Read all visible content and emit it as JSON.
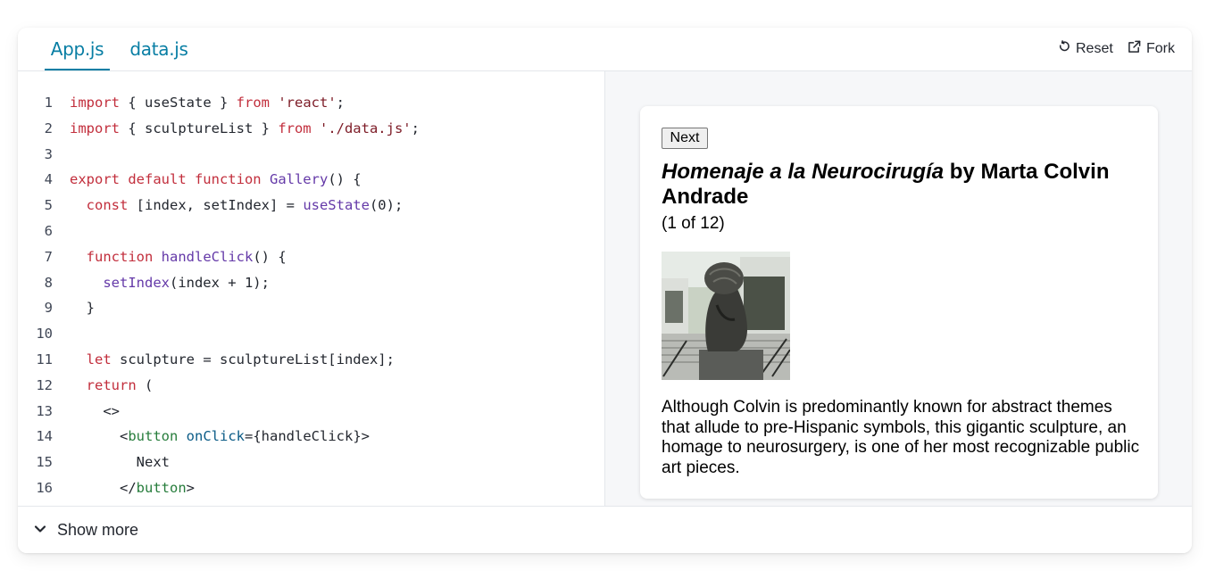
{
  "tabs": [
    {
      "label": "App.js",
      "active": true
    },
    {
      "label": "data.js",
      "active": false
    }
  ],
  "toolbar": {
    "reset_label": "Reset",
    "fork_label": "Fork"
  },
  "code": {
    "line_numbers": [
      "1",
      "2",
      "3",
      "4",
      "5",
      "6",
      "7",
      "8",
      "9",
      "10",
      "11",
      "12",
      "13",
      "14",
      "15",
      "16"
    ],
    "lines": [
      [
        {
          "t": "import",
          "c": "kw"
        },
        {
          "t": " { useState } "
        },
        {
          "t": "from",
          "c": "kw"
        },
        {
          "t": " "
        },
        {
          "t": "'react'",
          "c": "str"
        },
        {
          "t": ";"
        }
      ],
      [
        {
          "t": "import",
          "c": "kw"
        },
        {
          "t": " { sculptureList } "
        },
        {
          "t": "from",
          "c": "kw"
        },
        {
          "t": " "
        },
        {
          "t": "'./data.js'",
          "c": "str"
        },
        {
          "t": ";"
        }
      ],
      [],
      [
        {
          "t": "export default function",
          "c": "kw"
        },
        {
          "t": " "
        },
        {
          "t": "Gallery",
          "c": "fn"
        },
        {
          "t": "() {"
        }
      ],
      [
        {
          "t": "  "
        },
        {
          "t": "const",
          "c": "kw"
        },
        {
          "t": " [index, setIndex] = "
        },
        {
          "t": "useState",
          "c": "fn"
        },
        {
          "t": "(0);"
        }
      ],
      [],
      [
        {
          "t": "  "
        },
        {
          "t": "function",
          "c": "kw"
        },
        {
          "t": " "
        },
        {
          "t": "handleClick",
          "c": "fn"
        },
        {
          "t": "() {"
        }
      ],
      [
        {
          "t": "    "
        },
        {
          "t": "setIndex",
          "c": "fn"
        },
        {
          "t": "(index + 1);"
        }
      ],
      [
        {
          "t": "  }"
        }
      ],
      [],
      [
        {
          "t": "  "
        },
        {
          "t": "let",
          "c": "kw"
        },
        {
          "t": " sculpture = sculptureList[index];"
        }
      ],
      [
        {
          "t": "  "
        },
        {
          "t": "return",
          "c": "kw"
        },
        {
          "t": " ("
        }
      ],
      [
        {
          "t": "    <>"
        }
      ],
      [
        {
          "t": "      <"
        },
        {
          "t": "button",
          "c": "tag"
        },
        {
          "t": " "
        },
        {
          "t": "onClick",
          "c": "attr"
        },
        {
          "t": "={handleClick}>"
        }
      ],
      [
        {
          "t": "        Next"
        }
      ],
      [
        {
          "t": "      </"
        },
        {
          "t": "button",
          "c": "tag"
        },
        {
          "t": ">"
        }
      ]
    ]
  },
  "preview": {
    "button_label": "Next",
    "title_italic": "Homenaje a la Neurocirugía",
    "title_rest": " by Marta Colvin Andrade",
    "counter": "(1 of 12)",
    "description": "Although Colvin is predominantly known for abstract themes that allude to pre-Hispanic symbols, this gigantic sculpture, an homage to neurosurgery, is one of her most recognizable public art pieces."
  },
  "footer": {
    "show_more_label": "Show more"
  },
  "colors": {
    "accent": "#087ea4",
    "keyword": "#c22e3c",
    "string": "#7d1c27",
    "function": "#6439a8",
    "tag": "#277d3c",
    "attr": "#0a5b86"
  }
}
